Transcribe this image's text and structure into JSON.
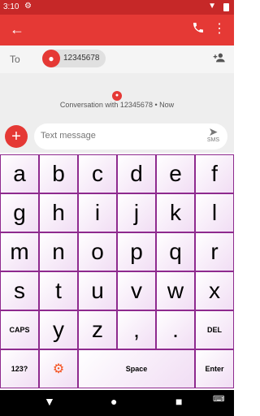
{
  "status": {
    "time": "3:10"
  },
  "appbar": {
    "back_icon": "arrow-left-icon",
    "call_icon": "phone-icon",
    "more_icon": "more-vert-icon"
  },
  "recipient": {
    "to_label": "To",
    "chip_number": "12345678"
  },
  "conversation": {
    "info": "Conversation with 12345678 • Now"
  },
  "compose": {
    "placeholder": "Text message",
    "send_label": "SMS"
  },
  "keyboard": {
    "rows": [
      [
        "a",
        "b",
        "c",
        "d",
        "e",
        "f"
      ],
      [
        "g",
        "h",
        "i",
        "j",
        "k",
        "l"
      ],
      [
        "m",
        "n",
        "o",
        "p",
        "q",
        "r"
      ],
      [
        "s",
        "t",
        "u",
        "v",
        "w",
        "x"
      ],
      [
        "CAPS",
        "y",
        "z",
        ",",
        ".",
        "DEL"
      ],
      [
        "123?",
        "settings",
        "Space",
        "Enter"
      ]
    ],
    "border_color": "#8e2a8e"
  },
  "colors": {
    "accent": "#e53935",
    "status": "#c62828"
  }
}
